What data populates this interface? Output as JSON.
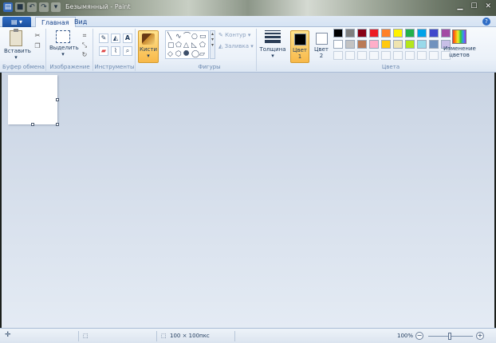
{
  "window": {
    "title": "Безымянный - Paint",
    "controls": [
      "minimize",
      "maximize",
      "close"
    ]
  },
  "tabs": {
    "file_label": "▤ ▾",
    "items": [
      "Главная",
      "Вид"
    ],
    "active": "Главная"
  },
  "ribbon": {
    "clipboard": {
      "paste_label": "Вставить",
      "group_label": "Буфер обмена"
    },
    "image": {
      "select_label": "Выделить",
      "group_label": "Изображение"
    },
    "tools": {
      "group_label": "Инструменты",
      "text_tool": "A"
    },
    "brushes": {
      "label": "Кисти"
    },
    "shapes": {
      "outline_label": "Контур",
      "fill_label": "Заливка",
      "group_label": "Фигуры"
    },
    "size": {
      "label": "Толщина"
    },
    "colors": {
      "color1_label": "Цвет",
      "color1_num": "1",
      "color2_label": "Цвет",
      "color2_num": "2",
      "edit_label": "Изменение цветов",
      "group_label": "Цвета",
      "color1": "#000000",
      "color2": "#ffffff",
      "palette": [
        "#000000",
        "#7f7f7f",
        "#880015",
        "#ed1c24",
        "#ff7f27",
        "#fff200",
        "#22b14c",
        "#00a2e8",
        "#3f48cc",
        "#a349a4",
        "#ffffff",
        "#c3c3c3",
        "#b97a57",
        "#ffaec9",
        "#ffc90e",
        "#efe4b0",
        "#b5e61d",
        "#99d9ea",
        "#7092be",
        "#c8bfe7",
        "",
        "",
        "",
        "",
        "",
        "",
        "",
        "",
        "",
        ""
      ]
    }
  },
  "statusbar": {
    "canvas_size": "100 × 100пкс",
    "zoom": "100%"
  }
}
